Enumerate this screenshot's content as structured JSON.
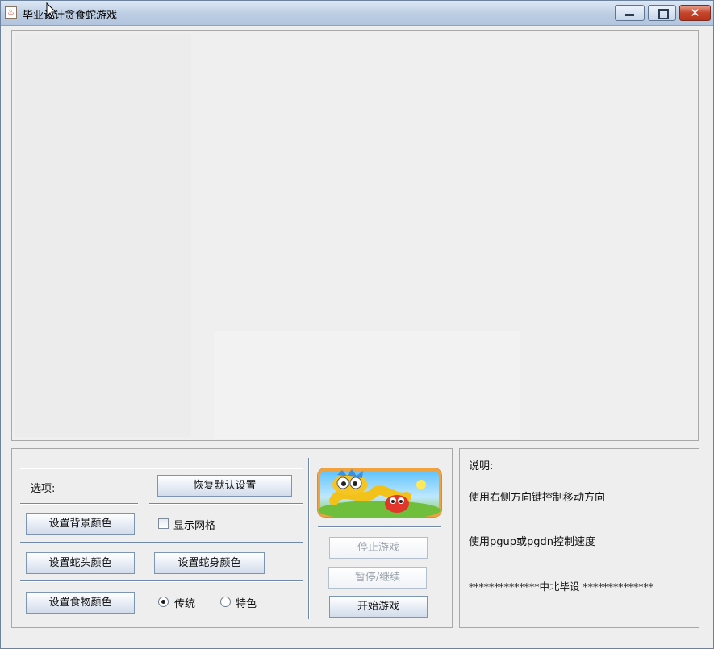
{
  "window": {
    "title": "毕业设计贪食蛇游戏",
    "close_glyph": "✕"
  },
  "options": {
    "label": "选项:",
    "reset_button": "恢复默认设置",
    "bg_color_button": "设置背景颜色",
    "show_grid_label": "显示网格",
    "show_grid_checked": false,
    "head_color_button": "设置蛇头颜色",
    "body_color_button": "设置蛇身颜色",
    "food_color_button": "设置食物颜色",
    "style_traditional_label": "传统",
    "style_special_label": "特色",
    "style_selected": "传统"
  },
  "controls": {
    "stop_button": "停止游戏",
    "pause_button": "暂停/继续",
    "start_button": "开始游戏",
    "image_icon": "snake-logo-icon"
  },
  "info": {
    "heading": "说明:",
    "line1": "使用右侧方向键控制移动方向",
    "line2": "使用pgup或pgdn控制速度",
    "line3": "**************中北毕设 **************"
  },
  "colors": {
    "title_gradient_top": "#dde8f5",
    "close_button": "#c4452b",
    "panel_background": "#eeeeee",
    "separator": "#6f88ac"
  }
}
